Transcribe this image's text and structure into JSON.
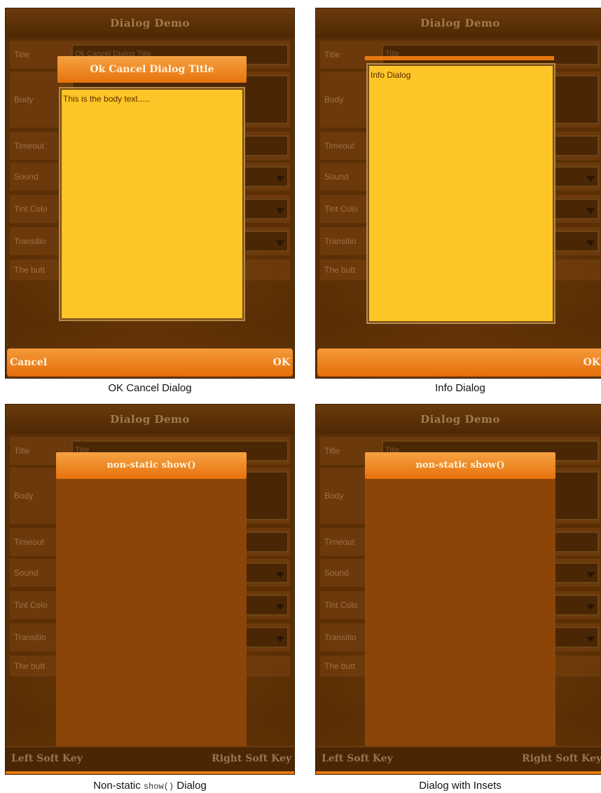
{
  "app": {
    "title": "Dialog Demo",
    "labels": {
      "title": "Title",
      "body": "Body",
      "timeout": "Timeout",
      "sound": "Sound",
      "tint": "Tint Colo",
      "transition": "Transitio",
      "buttons": "The butt"
    },
    "title_field_value": "Title"
  },
  "panels": [
    {
      "caption": "OK Cancel Dialog",
      "title_field_value": "Ok Cancel Dialog Title",
      "dialog_title": "Ok Cancel Dialog Title",
      "dialog_body": "This is the body text.....",
      "left_soft": "Cancel",
      "right_soft": "OK"
    },
    {
      "caption": "Info Dialog",
      "dialog_body": "Info Dialog",
      "right_soft": "OK"
    },
    {
      "caption_prefix": "Non-static",
      "caption_code": "show()",
      "caption_suffix": "Dialog",
      "dialog_title": "non-static show()",
      "left_soft": "Left Soft Key",
      "right_soft": "Right Soft Key"
    },
    {
      "caption": "Dialog with Insets",
      "dialog_title": "non-static show()",
      "left_soft": "Left Soft Key",
      "right_soft": "Right Soft Key"
    }
  ],
  "colors": {
    "background": "#5b2f05",
    "dialog_body": "#fdc626",
    "title_bar": "#e6720c",
    "dark_dialog": "#8b4509"
  }
}
